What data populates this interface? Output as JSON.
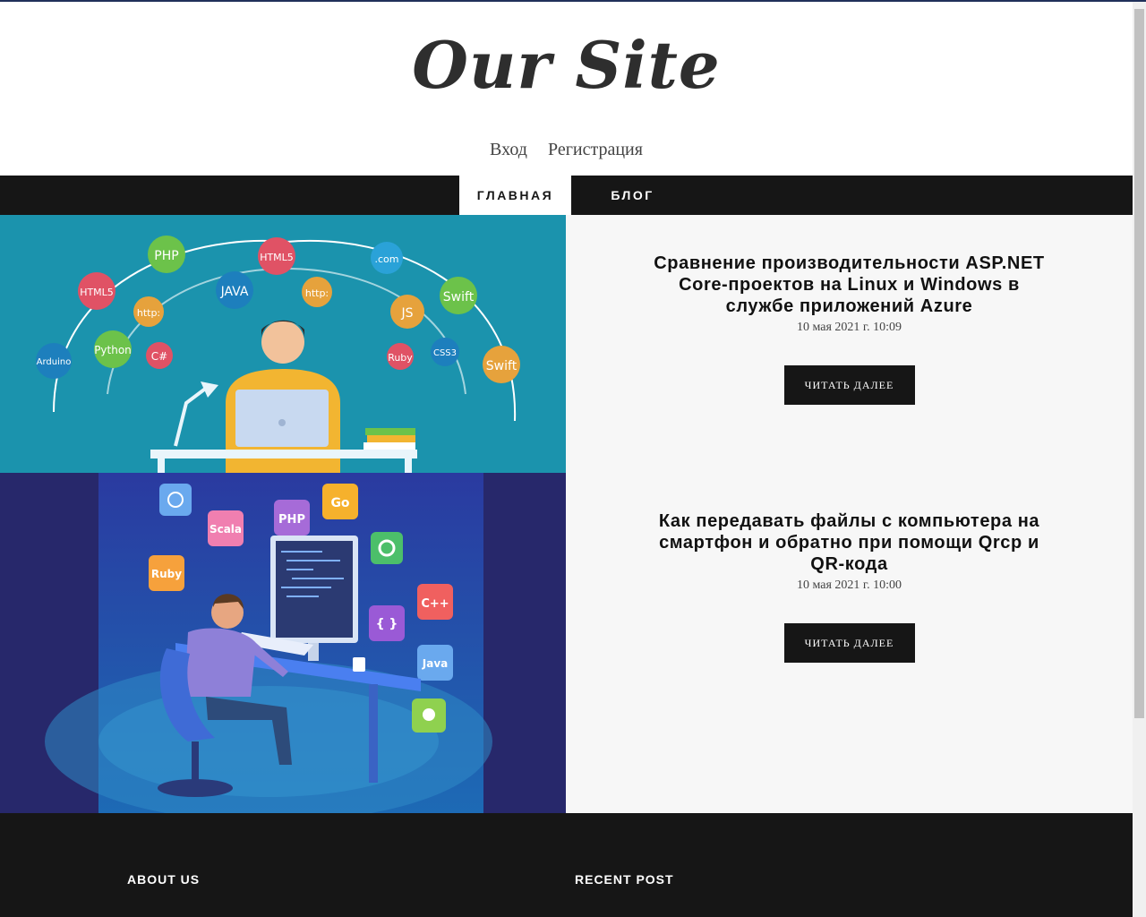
{
  "site": {
    "logo": "Our Site"
  },
  "auth": {
    "login": "Вход",
    "register": "Регистрация"
  },
  "nav": {
    "items": [
      {
        "label": "ГЛАВНАЯ",
        "active": true
      },
      {
        "label": "БЛОГ",
        "active": false
      }
    ]
  },
  "posts": [
    {
      "title": "Сравнение производительности ASP.NET Core-проектов на Linux и Windows в службе приложений Azure",
      "date": "10 мая 2021 г. 10:09",
      "button": "ЧИТАТЬ ДАЛЕЕ",
      "image_labels": [
        "PHP",
        "HTML5",
        "JAVA",
        "http:",
        ".com",
        "JS",
        "Swift",
        "HTML5",
        "http:",
        "Python",
        "C#",
        "Arduino",
        "Ruby",
        "CSS3",
        "Swift"
      ]
    },
    {
      "title": "Как передавать файлы с компьютера на смартфон и обратно при помощи Qrcp и QR-кода",
      "date": "10 мая 2021 г. 10:00",
      "button": "ЧИТАТЬ ДАЛЕЕ",
      "image_labels": [
        "Go",
        "PHP",
        "Scala",
        "Ruby",
        "C++",
        "{ }",
        "Java"
      ]
    }
  ],
  "footer": {
    "about": "ABOUT US",
    "recent": "RECENT POST"
  },
  "colors": {
    "nav_bg": "#161616",
    "thumb1_bg": "#1b93ad",
    "thumb2_bg": "#2a3a8c",
    "post_bg": "#f7f7f7"
  }
}
